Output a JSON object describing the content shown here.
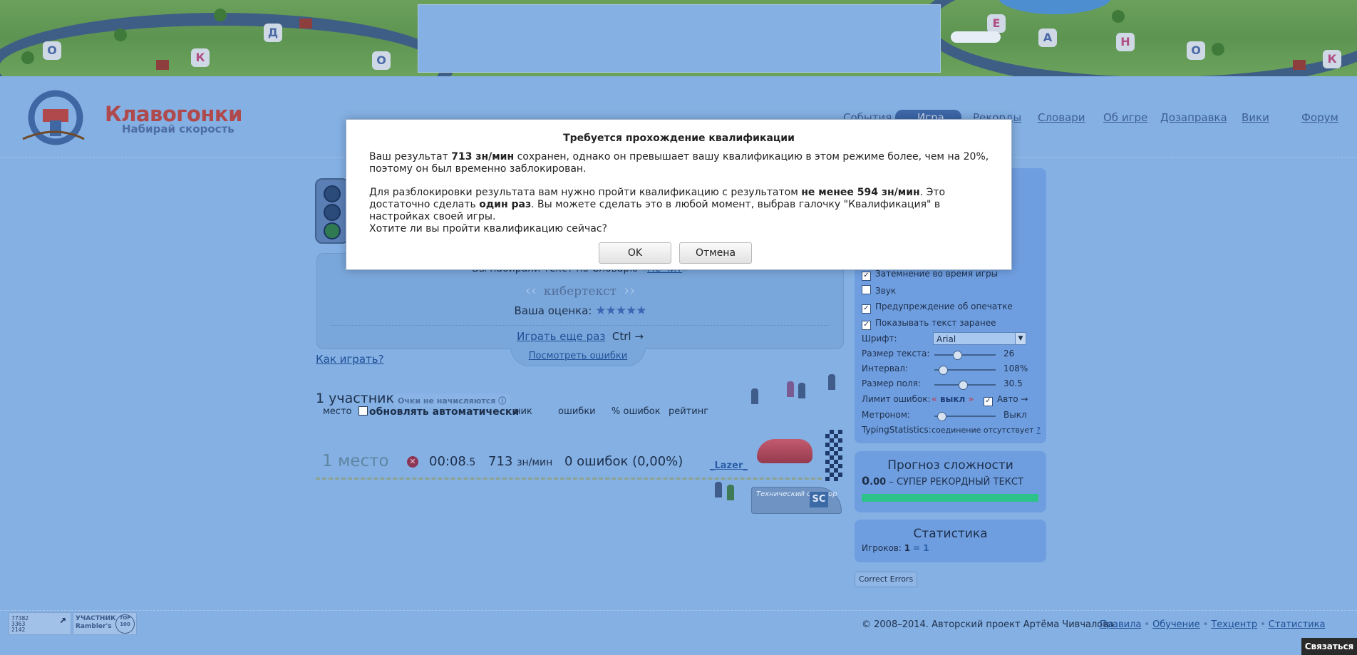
{
  "header": {
    "logo_title": "Клавогонки",
    "logo_subtitle": "Набирай скорость",
    "nav": [
      "События",
      "Игра",
      "Рекорды",
      "Словари",
      "Об игре",
      "Дозаправка",
      "Вики",
      "Форум"
    ],
    "nav_active": "Игра"
  },
  "banner_letters": [
    "О",
    "Д",
    "О",
    "К",
    "Е",
    "А",
    "Н",
    "О",
    "К"
  ],
  "result": {
    "line_prefix": "Вы набирали текст по Словарю «",
    "dictionary": "Не чит",
    "line_suffix": "»",
    "text_name": "кибертекст",
    "rating_label": "Ваша оценка:",
    "stars": "★★★★★",
    "play_again": "Играть еще раз",
    "play_again_hotkey": "Ctrl →",
    "view_errors": "Посмотреть ошибки"
  },
  "how_to_play": "Как играть?",
  "participants": {
    "count_label": "1 участник",
    "no_points": "Очки не начисляются",
    "col_place": "место",
    "auto_update": "обновлять автоматически",
    "col_nick": "ник",
    "col_errors": "ошибки",
    "col_error_pct": "% ошибок",
    "col_rating": "рейтинг"
  },
  "race": {
    "place": "1 место",
    "time_main": "00:08",
    "time_frac": ".5",
    "speed": "713",
    "speed_unit": "зн/мин",
    "errors": "0 ошибок (0,00%)",
    "nick": "_Lazer_",
    "sponsor_text": "Технический спонсор",
    "sponsor_logo": "SC"
  },
  "settings": {
    "options": [
      {
        "label": "Затемнение во время игры",
        "checked": true
      },
      {
        "label": "Звук",
        "checked": false
      },
      {
        "label": "Предупреждение об опечатке",
        "checked": true
      },
      {
        "label": "Показывать текст заранее",
        "checked": true
      }
    ],
    "font_label": "Шрифт:",
    "font_value": "Arial",
    "text_size_label": "Размер текста:",
    "text_size_value": "26",
    "text_size_level": 0.35,
    "interval_label": "Интервал:",
    "interval_value": "108%",
    "interval_level": 0.08,
    "field_size_label": "Размер поля:",
    "field_size_value": "30.5",
    "field_size_level": 0.45,
    "error_limit_label": "Лимит ошибок:",
    "error_limit_value": "выкл",
    "auto_label": "Авто →",
    "metronome_label": "Метроном:",
    "metronome_value": "Выкл",
    "metronome_level": 0.05,
    "typing_stats_label": "TypingStatistics:",
    "typing_stats_value": "соединение отсутствует",
    "typing_stats_help": "?"
  },
  "forecast": {
    "title": "Прогноз сложности",
    "value_int": "0",
    "value_frac": ".00",
    "label": "– СУПЕР РЕКОРДНЫЙ ТЕКСТ",
    "bar_fill": 1.0
  },
  "stats": {
    "title": "Статистика",
    "players_label": "Игроков:",
    "players_count": "1",
    "players_eq": "= 1"
  },
  "correct_errors": "Correct Errors",
  "footer": {
    "counter_lines": "77382\n3363\n2142",
    "rambler_text": "УЧАСТНИК\nRambler's",
    "rambler_badge": "TOP 100",
    "copyright": "© 2008–2014. Авторский проект Артёма Чивчалова.",
    "links": [
      "Правила",
      "Обучение",
      "Техцентр",
      "Статистика"
    ],
    "contact": "Связаться"
  },
  "modal": {
    "title": "Требуется прохождение квалификации",
    "p1_a": "Ваш результат ",
    "p1_b": "713 зн/мин",
    "p1_c": " сохранен, однако он превышает вашу квалификацию в этом режиме более, чем на 20%, поэтому он был временно заблокирован.",
    "p2_a": "Для разблокировки результата вам нужно пройти квалификацию с результатом ",
    "p2_b": "не менее 594 зн/мин",
    "p2_c": ". Это достаточно сделать ",
    "p2_d": "один раз",
    "p2_e": ". Вы можете сделать это в любой момент, выбрав галочку \"Квалификация\" в настройках своей игры.",
    "p3": "Хотите ли вы пройти квалификацию сейчас?",
    "ok": "OK",
    "cancel": "Отмена"
  }
}
